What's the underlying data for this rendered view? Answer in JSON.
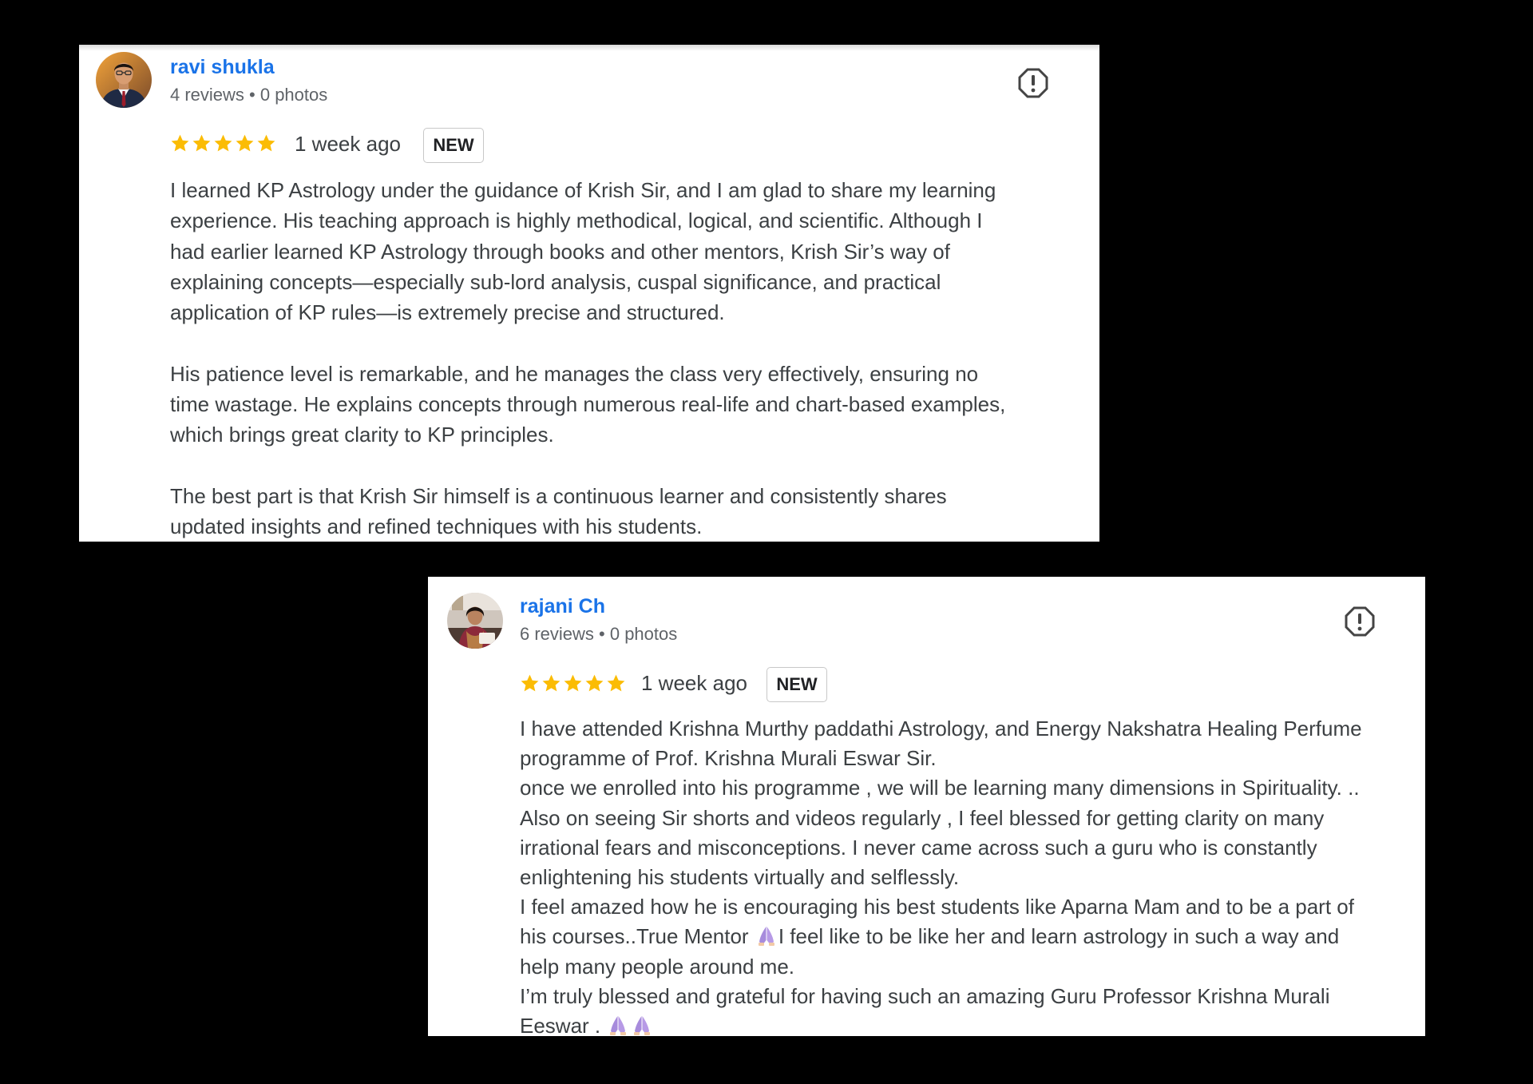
{
  "reviews": [
    {
      "reviewer": {
        "name": "ravi shukla",
        "stats": "4 reviews • 0 photos",
        "avatar_icon": "reviewer-photo-man-suit"
      },
      "rating": {
        "stars": 5,
        "max": 5,
        "color": "#fbbc04"
      },
      "time_ago": "1 week ago",
      "badge": "NEW",
      "report_icon": "exclamation-circle-icon",
      "paragraphs": [
        [
          "I learned KP Astrology under the guidance of Krish Sir, and I am glad to share my learning",
          "experience. His teaching approach is highly methodical, logical, and scientific. Although I",
          "had earlier learned KP Astrology through books and other mentors, Krish Sir’s way of",
          "explaining concepts—especially sub-lord analysis, cuspal significance, and practical",
          "application of KP rules—is extremely precise and structured."
        ],
        [
          "His patience level is remarkable, and he manages the class very effectively, ensuring no",
          "time wastage. He explains concepts through numerous real-life and chart-based examples,",
          "which brings great clarity to KP principles."
        ],
        [
          "The best part is that Krish Sir himself is a continuous learner and consistently shares",
          "updated insights and refined techniques with his students."
        ]
      ]
    },
    {
      "reviewer": {
        "name": "rajani Ch",
        "stats": "6 reviews • 0 photos",
        "avatar_icon": "reviewer-photo-woman"
      },
      "rating": {
        "stars": 5,
        "max": 5,
        "color": "#fbbc04"
      },
      "time_ago": "1 week ago",
      "badge": "NEW",
      "report_icon": "exclamation-circle-icon",
      "lines": [
        "I have attended Krishna Murthy paddathi Astrology, and Energy Nakshatra Healing Perfume",
        "programme of Prof. Krishna Murali Eswar Sir.",
        "once we enrolled into his programme , we will be learning many dimensions in Spirituality. ..",
        "Also on seeing Sir shorts and videos regularly , I feel blessed for getting clarity on many",
        "irrational fears and misconceptions. I never came across such a guru who is constantly",
        "enlightening his students virtually and selflessly.",
        "I feel amazed how he is encouraging his best students like Aparna Mam and to be a part of",
        {
          "before": "his courses..True Mentor ",
          "emoji": "folded-hands-emoji",
          "after": "I feel like to be like her and learn astrology in such a way and"
        },
        "help many people around me.",
        "I’m truly blessed and grateful for having such an amazing Guru Professor Krishna Murali",
        {
          "before": "Eeswar . ",
          "emoji": "folded-hands-emoji",
          "emoji_count": 2,
          "after": ""
        }
      ]
    }
  ]
}
